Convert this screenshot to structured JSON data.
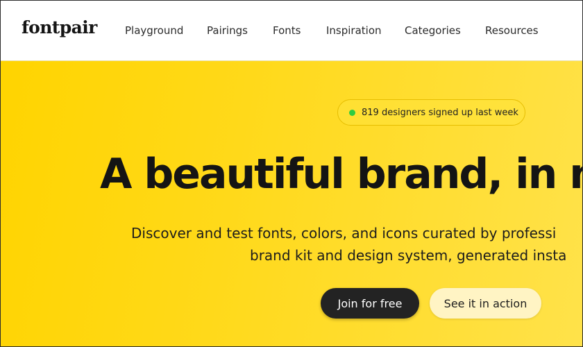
{
  "header": {
    "logo": "fontpair",
    "nav": [
      "Playground",
      "Pairings",
      "Fonts",
      "Inspiration",
      "Categories",
      "Resources"
    ]
  },
  "hero": {
    "badge": "819 designers signed up last week",
    "headline": "A beautiful brand, in m",
    "subtitle_line1": "Discover and test fonts, colors, and icons curated by professi",
    "subtitle_line2": "brand kit and design system, generated insta",
    "cta_primary": "Join for free",
    "cta_secondary": "See it in action"
  },
  "colors": {
    "hero_background": "#ffd400",
    "primary_button": "#232323",
    "secondary_button": "#fff4c4",
    "status_dot": "#2ecc40"
  },
  "icons": {
    "badge_indicator": "green-dot-icon"
  }
}
